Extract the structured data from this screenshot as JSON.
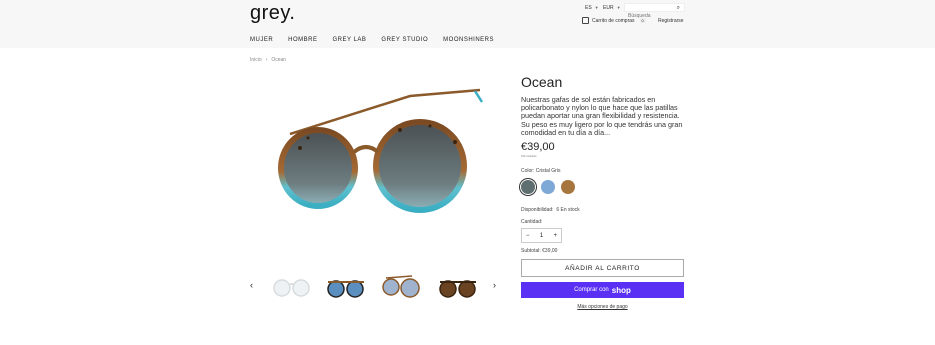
{
  "header": {
    "logo": "grey.",
    "language": "ES",
    "currency": "EUR",
    "search_placeholder": "Búsqueda",
    "cart_label": "Carrito de compras",
    "cart_count": "0",
    "register": "Registrarse"
  },
  "nav": [
    "MUJER",
    "HOMBRE",
    "GREY LAB",
    "GREY STUDIO",
    "MOONSHINERS"
  ],
  "breadcrumb": {
    "home": "Inicio",
    "current": "Ocean"
  },
  "product": {
    "title": "Ocean",
    "description": "Nuestras gafas de sol están fabricados en policarbonato y nylon lo que hace que las patillas puedan aportar una gran flexibilidad y resistencia. Su peso es muy ligero por lo que tendrás una gran comodidad en tu día a día...",
    "price": "€39,00",
    "tax_note": "IVA incluido",
    "color_label": "Color:",
    "color_value": "Cristal Gris",
    "swatch_colors": [
      "#5f6e70",
      "#7ea9d6",
      "#a6763e"
    ],
    "availability_label": "Disponibilidad:",
    "availability_value": "6 En stock",
    "quantity_label": "Cantidad:",
    "quantity": "1",
    "subtotal_label": "Subtotal:",
    "subtotal_value": "€39,00",
    "add_to_cart": "AÑADIR AL CARRITO",
    "buy_with": "Comprar con",
    "shop_brand": "shop",
    "more_options": "Más opciones de pago"
  },
  "colors": {
    "shop_pay": "#5a31f4",
    "frame_tortoise": "#8a5a2b",
    "lens_blue": "#4fb7c7"
  }
}
